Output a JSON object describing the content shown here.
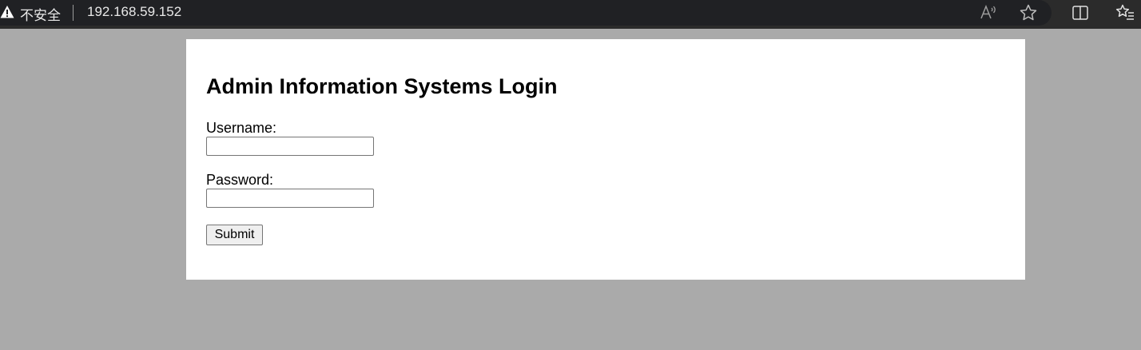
{
  "browser": {
    "security_label": "不安全",
    "url": "192.168.59.152",
    "icons": {
      "security": "warning-icon",
      "read_aloud": "read-aloud-icon",
      "favorite": "star-icon",
      "split_screen": "split-screen-icon",
      "favorites_list": "favorites-icon"
    }
  },
  "page": {
    "title": "Admin Information Systems Login",
    "username_label": "Username:",
    "username_value": "",
    "password_label": "Password:",
    "password_value": "",
    "submit_label": "Submit"
  },
  "colors": {
    "page_background": "#aaaaaa",
    "card_background": "#ffffff",
    "browser_bar": "#2b2b2b"
  }
}
